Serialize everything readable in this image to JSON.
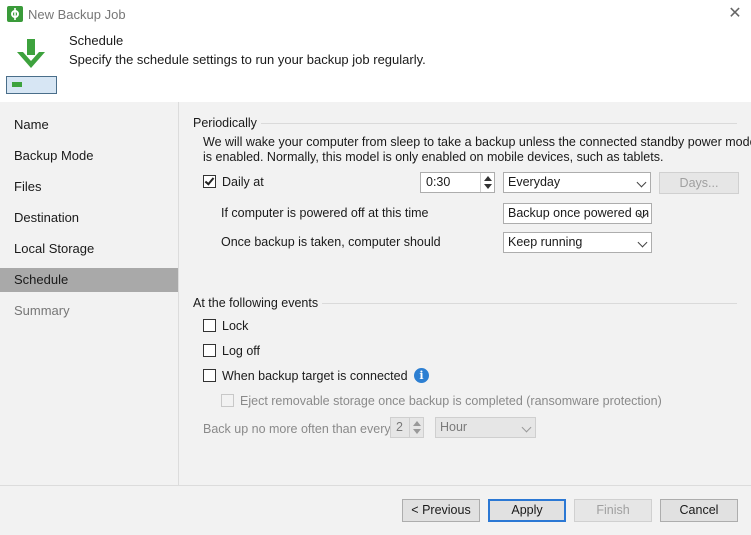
{
  "window": {
    "title": "New Backup Job",
    "close_glyph": "✕"
  },
  "header": {
    "title": "Schedule",
    "subtitle": "Specify the schedule settings to run your backup job regularly.",
    "icon": "download-to-drive-icon"
  },
  "sidebar": {
    "items": [
      {
        "label": "Name"
      },
      {
        "label": "Backup Mode"
      },
      {
        "label": "Files"
      },
      {
        "label": "Destination"
      },
      {
        "label": "Local Storage"
      },
      {
        "label": "Schedule"
      },
      {
        "label": "Summary"
      }
    ],
    "active": "Schedule"
  },
  "periodically": {
    "group_label": "Periodically",
    "description_line1": "We will wake your computer from sleep to take a backup unless the connected standby power model",
    "description_line2": "is enabled. Normally, this model is only enabled on mobile devices, such as tablets.",
    "daily_label": "Daily at",
    "daily_checked": true,
    "time_value": "0:30",
    "frequency_value": "Everyday",
    "days_button": "Days...",
    "powered_off_label": "If computer is powered off at this time",
    "powered_off_value": "Backup once powered on",
    "after_backup_label": "Once backup is taken, computer should",
    "after_backup_value": "Keep running"
  },
  "events": {
    "group_label": "At the following events",
    "lock_label": "Lock",
    "logoff_label": "Log off",
    "target_connected_label": "When backup target is connected",
    "eject_label": "Eject removable storage once backup is completed (ransomware protection)",
    "no_more_often_label": "Back up no more often than every",
    "interval_value": "2",
    "interval_unit": "Hour"
  },
  "footer": {
    "previous": "< Previous",
    "apply": "Apply",
    "finish": "Finish",
    "cancel": "Cancel"
  },
  "colors": {
    "accent": "#2b78d4",
    "sidebar_active": "#a9a9a9",
    "panel_bg": "#f2f2f2",
    "brand_green": "#3a9b3a"
  }
}
